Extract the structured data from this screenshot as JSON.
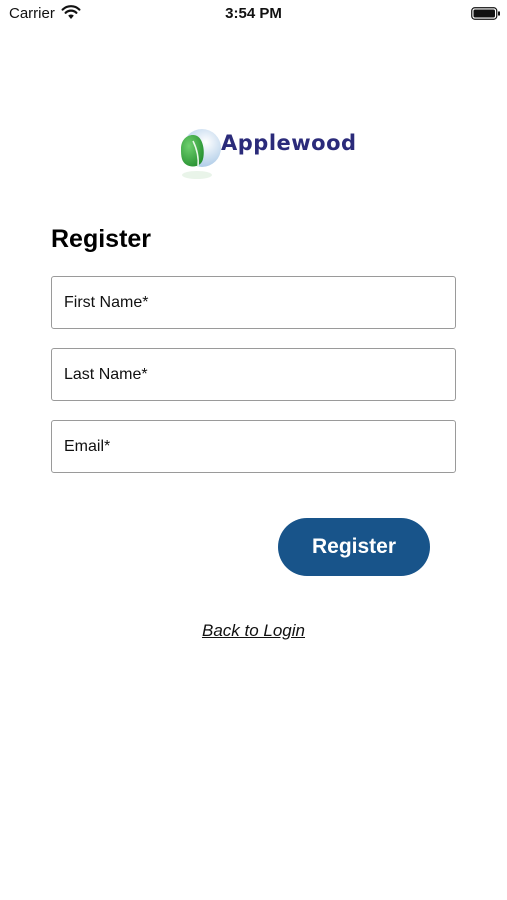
{
  "status_bar": {
    "carrier": "Carrier",
    "time": "3:54 PM",
    "wifi_icon": "wifi-icon",
    "battery_icon": "battery-icon"
  },
  "logo": {
    "text": "Applewood",
    "icon": "applewood-logo-icon",
    "colors": {
      "text": "#2b2b7a",
      "leaf_green": "#3aa63a",
      "globe_blue": "#bcd6ee"
    }
  },
  "form": {
    "title": "Register",
    "first_name_placeholder": "First Name*",
    "last_name_placeholder": "Last Name*",
    "email_placeholder": "Email*",
    "first_name_value": "",
    "last_name_value": "",
    "email_value": ""
  },
  "register_button": {
    "label": "Register",
    "color": "#18548a"
  },
  "back_link": {
    "label": "Back to Login"
  }
}
